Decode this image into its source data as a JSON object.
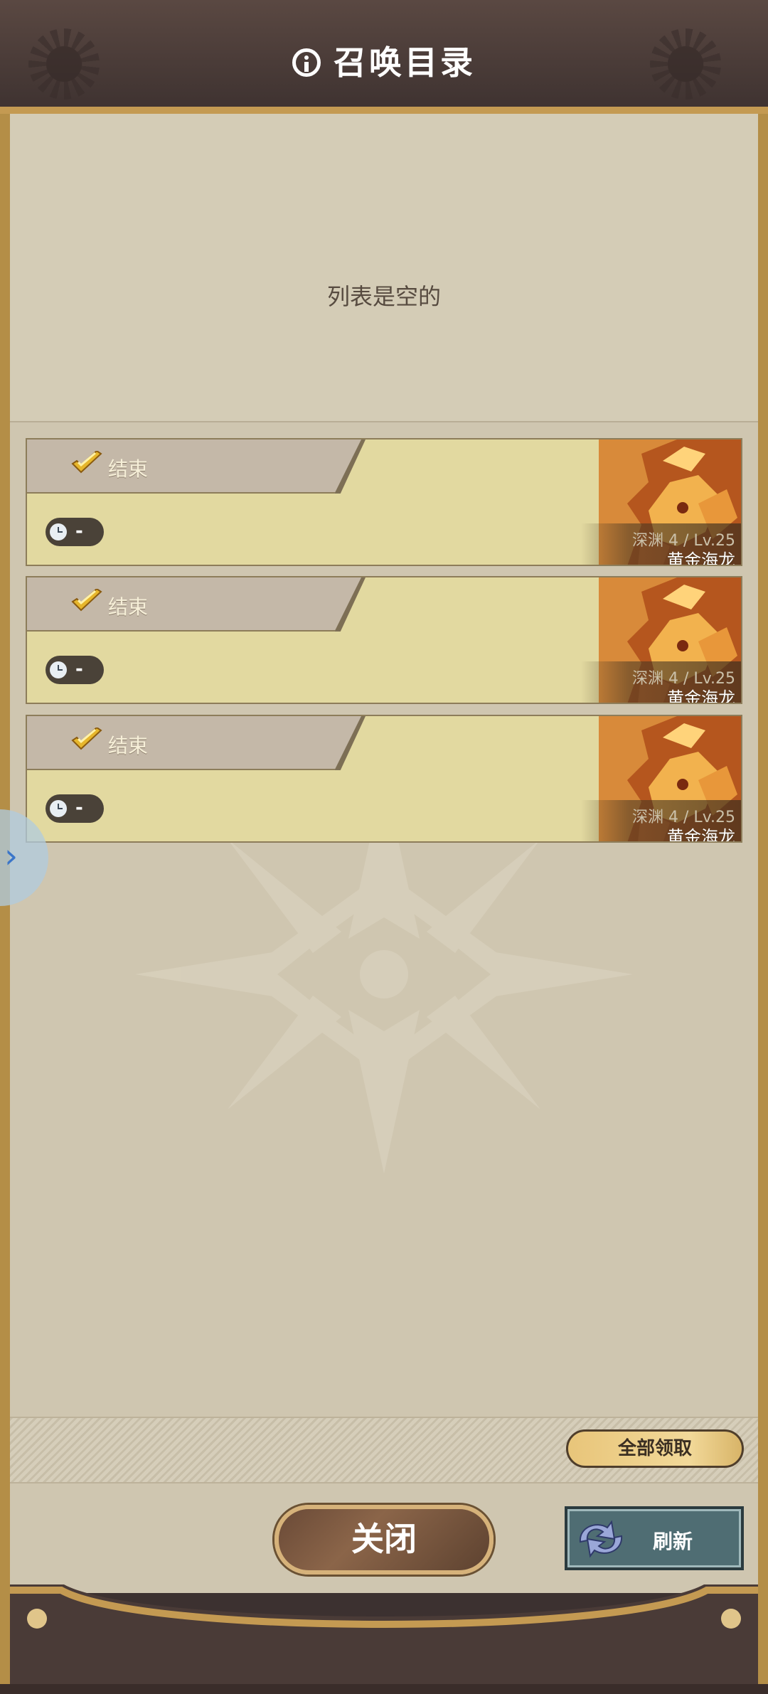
{
  "header": {
    "title": "召唤目录",
    "icon": "info-icon"
  },
  "main": {
    "empty_message": "列表是空的"
  },
  "records": [
    {
      "status": "结束",
      "timer": "-",
      "dungeon": "深渊 4 / Lv.25",
      "monster": "黄金海龙"
    },
    {
      "status": "结束",
      "timer": "-",
      "dungeon": "深渊 4 / Lv.25",
      "monster": "黄金海龙"
    },
    {
      "status": "结束",
      "timer": "-",
      "dungeon": "深渊 4 / Lv.25",
      "monster": "黄金海龙"
    }
  ],
  "footer": {
    "claim_all_label": "全部领取",
    "close_label": "关闭",
    "refresh_label": "刷新"
  },
  "colors": {
    "panel_bg": "#cfc6b0",
    "card_bg": "#e2d9a0",
    "frame_gold": "#b48e47",
    "header_bg": "#4a3c38"
  }
}
